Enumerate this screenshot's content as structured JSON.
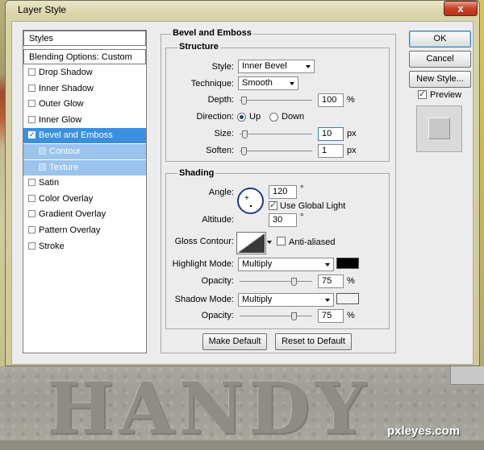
{
  "window": {
    "title": "Layer Style",
    "close_glyph": "x"
  },
  "styles_panel": {
    "header": "Styles",
    "blending": "Blending Options: Custom",
    "items": [
      {
        "label": "Drop Shadow",
        "checked": false
      },
      {
        "label": "Inner Shadow",
        "checked": false
      },
      {
        "label": "Outer Glow",
        "checked": false
      },
      {
        "label": "Inner Glow",
        "checked": false
      },
      {
        "label": "Bevel and Emboss",
        "checked": true,
        "selected": true
      },
      {
        "label": "Contour",
        "checked": false,
        "sub": true
      },
      {
        "label": "Texture",
        "checked": false,
        "sub": true
      },
      {
        "label": "Satin",
        "checked": false
      },
      {
        "label": "Color Overlay",
        "checked": false
      },
      {
        "label": "Gradient Overlay",
        "checked": false
      },
      {
        "label": "Pattern Overlay",
        "checked": false
      },
      {
        "label": "Stroke",
        "checked": false
      }
    ]
  },
  "bevel": {
    "title": "Bevel and Emboss",
    "structure": {
      "title": "Structure",
      "style_label": "Style:",
      "style_value": "Inner Bevel",
      "technique_label": "Technique:",
      "technique_value": "Smooth",
      "depth_label": "Depth:",
      "depth_value": "100",
      "depth_unit": "%",
      "depth_level": 0.02,
      "direction_label": "Direction:",
      "dir_up": "Up",
      "dir_down": "Down",
      "direction": "Up",
      "size_label": "Size:",
      "size_value": "10",
      "size_unit": "px",
      "size_level": 0.04,
      "soften_label": "Soften:",
      "soften_value": "1",
      "soften_unit": "px",
      "soften_level": 0.02
    },
    "shading": {
      "title": "Shading",
      "angle_label": "Angle:",
      "angle_value": "120",
      "angle_unit": "°",
      "global_light_label": "Use Global Light",
      "global_light": true,
      "altitude_label": "Altitude:",
      "altitude_value": "30",
      "altitude_unit": "°",
      "gloss_label": "Gloss Contour:",
      "anti_aliased_label": "Anti-aliased",
      "anti_aliased": false,
      "highlight_label": "Highlight Mode:",
      "highlight_value": "Multiply",
      "highlight_color": "#000000",
      "hl_opacity_label": "Opacity:",
      "hl_opacity_value": "75",
      "hl_opacity_unit": "%",
      "hl_opacity_level": 0.75,
      "shadow_label": "Shadow Mode:",
      "shadow_value": "Multiply",
      "shadow_color": "#f2f2f2",
      "sh_opacity_label": "Opacity:",
      "sh_opacity_value": "75",
      "sh_opacity_unit": "%",
      "sh_opacity_level": 0.75
    },
    "make_default": "Make Default",
    "reset_default": "Reset to Default"
  },
  "buttons": {
    "ok": "OK",
    "cancel": "Cancel",
    "new_style": "New Style...",
    "preview_label": "Preview",
    "preview_checked": true
  },
  "background": {
    "stone_text": "HANDY",
    "watermark": "pxleyes.com"
  }
}
